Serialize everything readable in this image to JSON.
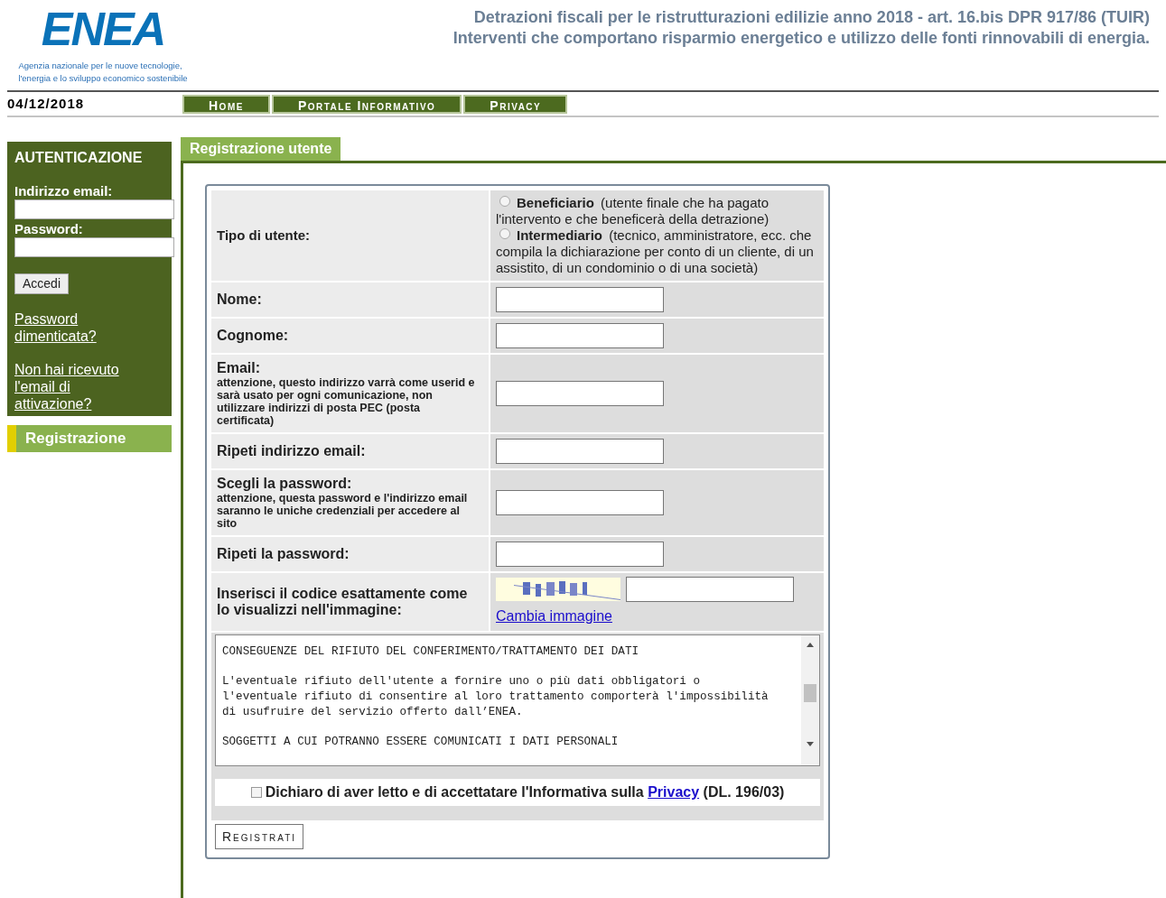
{
  "header": {
    "logo": "ENEA",
    "tagline": [
      "Agenzia nazionale per le nuove tecnologie,",
      "l'energia e lo sviluppo economico sostenibile"
    ],
    "titles": [
      "Detrazioni fiscali per le ristrutturazioni edilizie anno 2018 - art. 16.bis DPR 917/86 (TUIR)",
      "Interventi che comportano risparmio energetico e utilizzo delle fonti rinnovabili di energia."
    ]
  },
  "date": "04/12/2018",
  "nav": [
    "Home",
    "Portale Informativo",
    "Privacy"
  ],
  "sidebar": {
    "title": "AUTENTICAZIONE",
    "email_label": "Indirizzo email:",
    "password_label": "Password:",
    "login_button": "Accedi",
    "links": [
      "Password dimenticata?",
      "Non hai ricevuto l'email di attivazione?"
    ],
    "register": "Registrazione"
  },
  "tab": "Registrazione utente",
  "form": {
    "user_type": {
      "label": "Tipo di utente:",
      "options": [
        {
          "title": "Beneficiario",
          "description": "(utente finale che ha pagato l'intervento e che beneficerà della detrazione)",
          "selected": false
        },
        {
          "title": "Intermediario",
          "description": "(tecnico, amministratore, ecc. che compila la dichiarazione per conto di un cliente, di un assistito, di un condominio o di una società)",
          "selected": false
        }
      ]
    },
    "fields": [
      {
        "label": "Nome:"
      },
      {
        "label": "Cognome:"
      },
      {
        "label": "Email:",
        "note": "attenzione, questo indirizzo varrà come userid e sarà usato per ogni comunicazione, non utilizzare indirizzi di posta PEC (posta certificata)"
      },
      {
        "label": "Ripeti indirizzo email:"
      },
      {
        "label": "Scegli la password:",
        "note": "attenzione, questa password e l'indirizzo email saranno le uniche credenziali per accedere al sito"
      },
      {
        "label": "Ripeti la password:"
      }
    ],
    "captcha": {
      "label": "Inserisci il codice esattamente come lo visualizzi nell'immagine:",
      "change_link": "Cambia immagine"
    },
    "privacy_text": [
      [
        "CONSEGUENZE DEL RIFIUTO DEL CONFERIMENTO/TRATTAMENTO DEI DATI"
      ],
      [
        "L'eventuale rifiuto dell'utente a fornire uno o più dati obbligatori o",
        "l'eventuale rifiuto di consentire al loro trattamento comporterà l'impossibilità",
        "di usufruire del servizio offerto dall’ENEA."
      ],
      [
        "SOGGETTI A CUI POTRANNO ESSERE COMUNICATI I DATI PERSONALI"
      ]
    ],
    "consent": {
      "text": "Dichiaro di aver letto e di accettatare l'Informativa sulla",
      "link": "Privacy",
      "suffix": "(DL. 196/03)",
      "checked": false
    },
    "submit": "Registrati"
  }
}
